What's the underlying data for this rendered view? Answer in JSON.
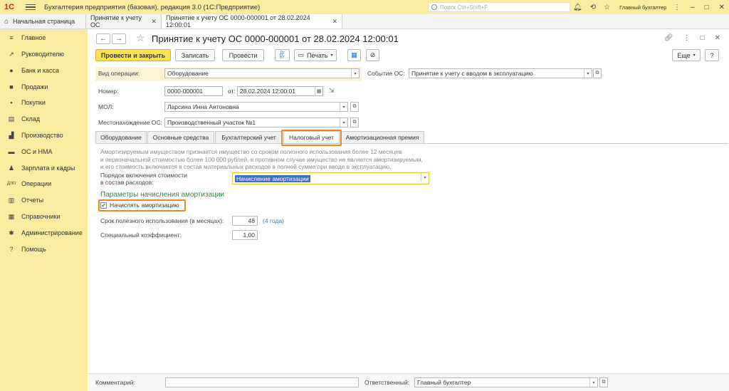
{
  "app": {
    "title": "Бухгалтерия предприятия (базовая), редакция 3.0  (1С:Предприятие)",
    "logo": "1С",
    "search_placeholder": "Поиск Ctrl+Shift+F",
    "user": "Главный бухгалтер"
  },
  "tabs": [
    {
      "label": "Начальная страница"
    },
    {
      "label": "Принятие к учету ОС"
    },
    {
      "label": "Принятие к учету ОС 0000-000001 от 28.02.2024 12:00:01"
    }
  ],
  "sidebar": {
    "items": [
      {
        "label": "Главное",
        "icon": "menu-icon"
      },
      {
        "label": "Руководителю",
        "icon": "chart-line-icon"
      },
      {
        "label": "Банк и касса",
        "icon": "coins-icon"
      },
      {
        "label": "Продажи",
        "icon": "bag-icon"
      },
      {
        "label": "Покупки",
        "icon": "cart-icon"
      },
      {
        "label": "Склад",
        "icon": "warehouse-icon"
      },
      {
        "label": "Производство",
        "icon": "factory-icon"
      },
      {
        "label": "ОС и НМА",
        "icon": "truck-icon"
      },
      {
        "label": "Зарплата и кадры",
        "icon": "person-icon"
      },
      {
        "label": "Операции",
        "icon": "dt-kt-icon"
      },
      {
        "label": "Отчеты",
        "icon": "report-icon"
      },
      {
        "label": "Справочники",
        "icon": "book-icon"
      },
      {
        "label": "Администрирование",
        "icon": "gear-icon"
      },
      {
        "label": "Помощь",
        "icon": "question-icon"
      }
    ]
  },
  "doc": {
    "title": "Принятие к учету ОС 0000-000001 от 28.02.2024 12:00:01"
  },
  "toolbar": {
    "post_close": "Провести и закрыть",
    "save": "Записать",
    "post": "Провести",
    "print": "Печать",
    "more": "Еще",
    "help": "?"
  },
  "form": {
    "op_type_label": "Вид операции:",
    "op_type_value": "Оборудование",
    "event_label": "Событие ОС:",
    "event_value": "Принятие к учету с вводом в эксплуатацию",
    "number_label": "Номер:",
    "number_value": "0000-000001",
    "from_label": "от:",
    "date_value": "28.02.2024 12:00:01",
    "mol_label": "МОЛ:",
    "mol_value": "Ларсина Инна Антоновна",
    "location_label": "Местонахождение ОС:",
    "location_value": "Производственный участок №1"
  },
  "form_tabs": [
    {
      "label": "Оборудование"
    },
    {
      "label": "Основные средства"
    },
    {
      "label": "Бухгалтерский учет"
    },
    {
      "label": "Налоговый учет"
    },
    {
      "label": "Амортизационная премия"
    }
  ],
  "tax": {
    "info_1": "Амортизируемым имуществом признается имущество со сроком полезного использования более 12 месяцев",
    "info_2": "и первоначальной стоимостью более 100 000 рублей, в противном случае имущество не является амортизируемым,",
    "info_3": "и его стоимость включается в состав материальных расходов в полной сумме при вводе в эксплуатацию.",
    "order_label_1": "Порядок включения стоимости",
    "order_label_2": "в состав расходов:",
    "order_value": "Начисление амортизации",
    "section_title": "Параметры начисления амортизации",
    "accrue_label": "Начислять амортизацию",
    "accrue_checked": true,
    "term_label": "Срок полезного использования (в месяцах):",
    "term_value": "48",
    "term_years": "(4 года)",
    "coef_label": "Специальный коэффициент:",
    "coef_value": "1,00"
  },
  "footer": {
    "comment_label": "Комментарий:",
    "comment_value": "",
    "responsible_label": "Ответственный:",
    "responsible_value": "Главный бухгалтер"
  },
  "colors": {
    "sidebar_bg": "#fbeb9e",
    "primary_button": "#fde24d",
    "highlight": "#e8872f",
    "section_green": "#2e8b3d"
  }
}
